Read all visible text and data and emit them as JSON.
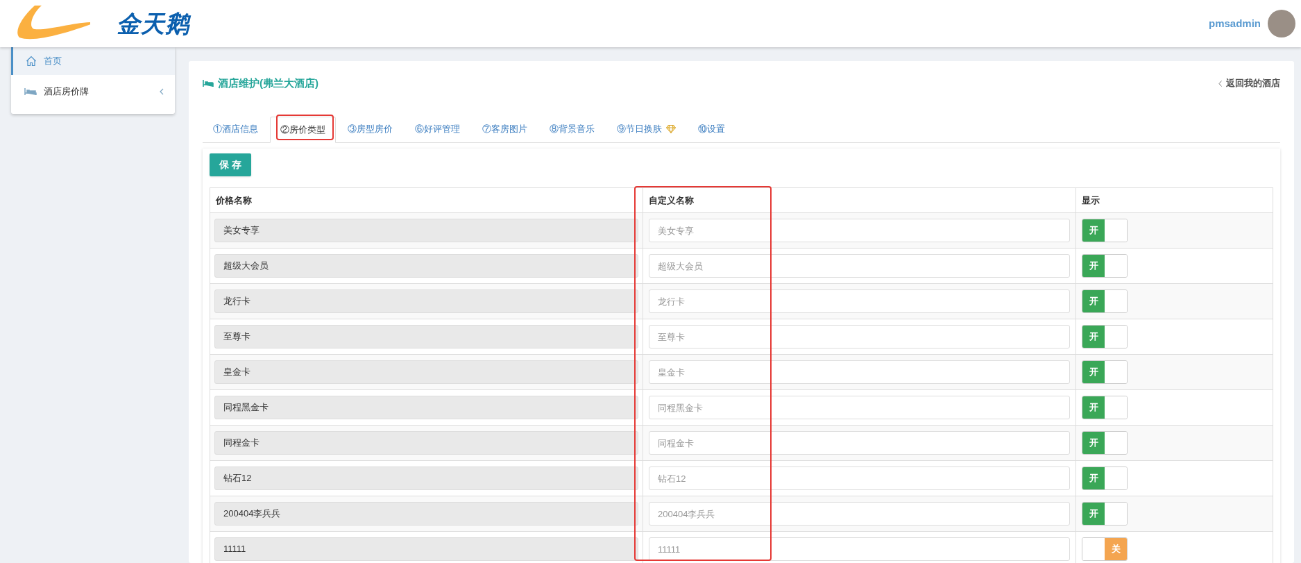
{
  "header": {
    "brand": "金天鹅",
    "username": "pmsadmin"
  },
  "sidebar": {
    "items": [
      {
        "label": "首页",
        "selected": true,
        "expandable": false
      },
      {
        "label": "酒店房价牌",
        "selected": false,
        "expandable": true
      }
    ]
  },
  "panel": {
    "title": "酒店维护(弗兰大酒店)",
    "back_link": "返回我的酒店"
  },
  "tabs": [
    {
      "label": "①酒店信息",
      "selected": false,
      "gem": false,
      "highlighted": false
    },
    {
      "label": "②房价类型",
      "selected": true,
      "gem": false,
      "highlighted": true
    },
    {
      "label": "③房型房价",
      "selected": false,
      "gem": false,
      "highlighted": false
    },
    {
      "label": "⑥好评管理",
      "selected": false,
      "gem": false,
      "highlighted": false
    },
    {
      "label": "⑦客房图片",
      "selected": false,
      "gem": false,
      "highlighted": false
    },
    {
      "label": "⑧背景音乐",
      "selected": false,
      "gem": false,
      "highlighted": false
    },
    {
      "label": "⑨节日换肤",
      "selected": false,
      "gem": true,
      "highlighted": false
    },
    {
      "label": "⑩设置",
      "selected": false,
      "gem": false,
      "highlighted": false
    }
  ],
  "save_button": "保 存",
  "table": {
    "columns": [
      {
        "label": "价格名称",
        "highlighted": false
      },
      {
        "label": "自定义名称",
        "highlighted": true
      },
      {
        "label": "显示",
        "highlighted": false
      }
    ],
    "rows": [
      {
        "name": "美女专享",
        "placeholder": "美女专享",
        "on": true,
        "switch_label": "开"
      },
      {
        "name": "超级大会员",
        "placeholder": "超级大会员",
        "on": true,
        "switch_label": "开"
      },
      {
        "name": "龙行卡",
        "placeholder": "龙行卡",
        "on": true,
        "switch_label": "开"
      },
      {
        "name": "至尊卡",
        "placeholder": "至尊卡",
        "on": true,
        "switch_label": "开"
      },
      {
        "name": "皇金卡",
        "placeholder": "皇金卡",
        "on": true,
        "switch_label": "开"
      },
      {
        "name": "同程黑金卡",
        "placeholder": "同程黑金卡",
        "on": true,
        "switch_label": "开"
      },
      {
        "name": "同程金卡",
        "placeholder": "同程金卡",
        "on": true,
        "switch_label": "开"
      },
      {
        "name": "钻石12",
        "placeholder": "钻石12",
        "on": true,
        "switch_label": "开"
      },
      {
        "name": "200404李兵兵",
        "placeholder": "200404李兵兵",
        "on": true,
        "switch_label": "开"
      },
      {
        "name": "11111",
        "placeholder": "11111",
        "on": false,
        "switch_label": "关"
      }
    ]
  }
}
